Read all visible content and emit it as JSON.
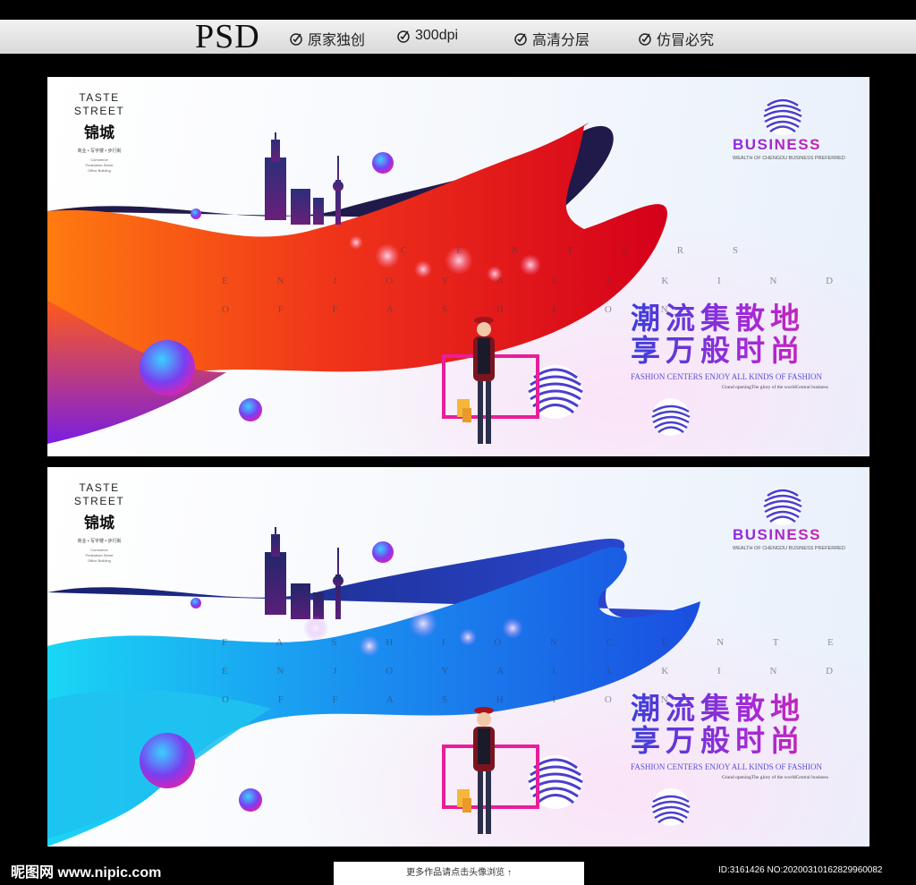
{
  "topbar": {
    "psd": "PSD",
    "features": [
      "原家独创",
      "300dpi",
      "高清分层",
      "仿冒必究"
    ]
  },
  "posters": [
    {
      "theme": "red",
      "brand": {
        "line1": "TASTE",
        "line2": "STREET",
        "name": "锦城",
        "tagline": "商业 • 写字楼 • 步行街",
        "small_lines": [
          "Commerce",
          "Pedestrian Street",
          "Office Building"
        ]
      },
      "business": {
        "title": "BUSINESS",
        "subtitle": "WEALTH OF CHENGDU    BUSINESS PREFERRED"
      },
      "scatter": [
        "C E N T E R S",
        "E N J O Y   A L L   K I N D S",
        "O F   F A S H I O N"
      ],
      "slogan": {
        "line1": "潮流集散地",
        "line2": "享万般时尚",
        "english": "FASHION CENTERS ENJOY ALL KINDS OF FASHION",
        "english_small": "Grand openingThe glory of the worldCentral business"
      }
    },
    {
      "theme": "blue",
      "brand": {
        "line1": "TASTE",
        "line2": "STREET",
        "name": "锦城",
        "tagline": "商业 • 写字楼 • 步行街",
        "small_lines": [
          "Commerce",
          "Pedestrian Street",
          "Office Building"
        ]
      },
      "business": {
        "title": "BUSINESS",
        "subtitle": "WEALTH OF CHENGDU    BUSINESS PREFERRED"
      },
      "scatter": [
        "F A S H I O N   C E N T E R S",
        "E N J O Y   A L L   K I N D S",
        "O F   F A S H I O N"
      ],
      "slogan": {
        "line1": "潮流集散地",
        "line2": "享万般时尚",
        "english": "FASHION CENTERS ENJOY ALL KINDS OF FASHION",
        "english_small": "Grand openingThe glory of the worldCentral business"
      }
    }
  ],
  "footer": {
    "site_logo": "昵图网 www.nipic.com",
    "more_button": "更多作品请点击头像浏览 ↑",
    "id_text": "ID:3161426 NO:20200310162829960082"
  },
  "colors": {
    "red_wave": "#f0231a",
    "orange_wave": "#ff6a10",
    "blue_wave": "#1a8df0",
    "navy_wave": "#1c2a8c",
    "accent_pink": "#e81e9a",
    "accent_purple": "#7a2ee0"
  }
}
